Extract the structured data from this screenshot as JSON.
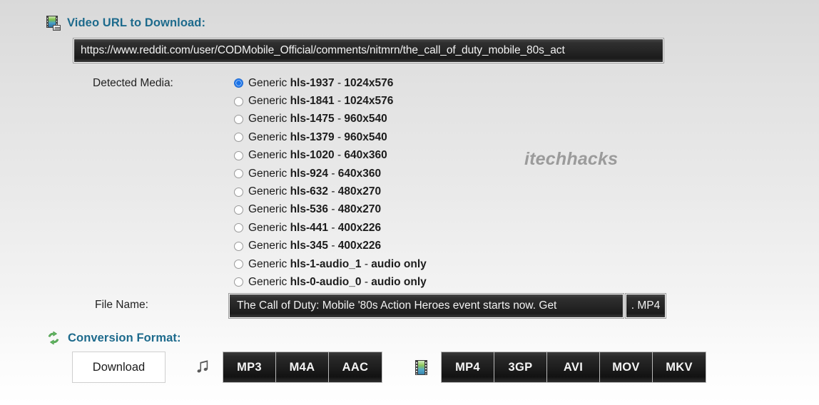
{
  "sections": {
    "video_url": {
      "icon": "film-icon",
      "title": "Video URL to Download:",
      "url_value": "https://www.reddit.com/user/CODMobile_Official/comments/nitmrn/the_call_of_duty_mobile_80s_act",
      "url_placeholder": "Paste video URL here"
    },
    "conversion": {
      "icon": "convert-arrows-icon",
      "title": "Conversion Format:"
    }
  },
  "detected_media": {
    "label": "Detected Media:",
    "selected_index": 0,
    "options": [
      {
        "prefix": "Generic",
        "id": "hls-1937",
        "detail": "1024x576"
      },
      {
        "prefix": "Generic",
        "id": "hls-1841",
        "detail": "1024x576"
      },
      {
        "prefix": "Generic",
        "id": "hls-1475",
        "detail": "960x540"
      },
      {
        "prefix": "Generic",
        "id": "hls-1379",
        "detail": "960x540"
      },
      {
        "prefix": "Generic",
        "id": "hls-1020",
        "detail": "640x360"
      },
      {
        "prefix": "Generic",
        "id": "hls-924",
        "detail": "640x360"
      },
      {
        "prefix": "Generic",
        "id": "hls-632",
        "detail": "480x270"
      },
      {
        "prefix": "Generic",
        "id": "hls-536",
        "detail": "480x270"
      },
      {
        "prefix": "Generic",
        "id": "hls-441",
        "detail": "400x226"
      },
      {
        "prefix": "Generic",
        "id": "hls-345",
        "detail": "400x226"
      },
      {
        "prefix": "Generic",
        "id": "hls-1-audio_1",
        "detail": "audio only"
      },
      {
        "prefix": "Generic",
        "id": "hls-0-audio_0",
        "detail": "audio only"
      }
    ]
  },
  "file_name": {
    "label": "File Name:",
    "value": "The Call of Duty: Mobile '80s Action Heroes event starts now. Get",
    "placeholder": "Enter file name",
    "extension": ". MP4"
  },
  "actions": {
    "download_label": "Download",
    "audio_icon": "music-note-icon",
    "video_icon": "film-strip-icon",
    "audio_formats": [
      "MP3",
      "M4A",
      "AAC"
    ],
    "video_formats": [
      "MP4",
      "3GP",
      "AVI",
      "MOV",
      "MKV"
    ]
  },
  "watermark": "itechhacks",
  "colors": {
    "heading": "#1d6a8c",
    "radio_selected": "#1a73e8",
    "field_background": "#242424",
    "field_text": "#f2f2f2",
    "convert_icon_green": "#5fb55f",
    "watermark_gray": "#9b9b9b"
  }
}
